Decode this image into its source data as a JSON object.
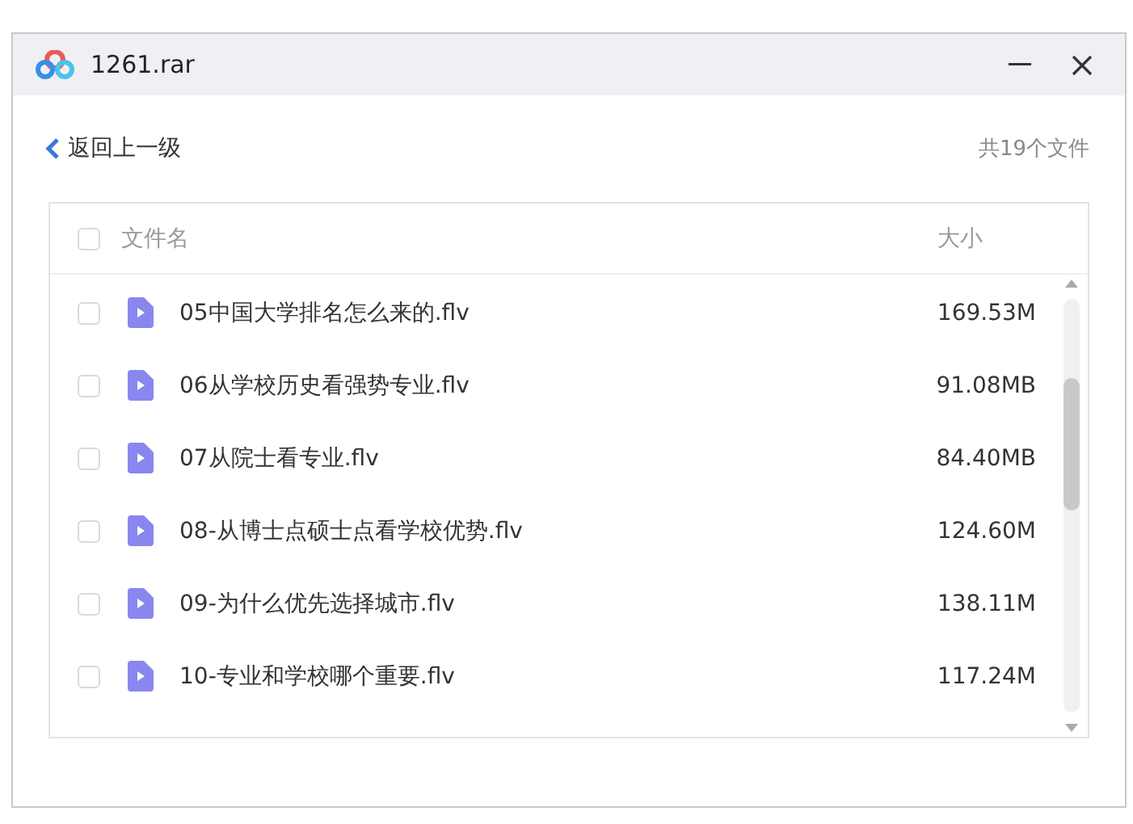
{
  "window": {
    "title": "1261.rar"
  },
  "toolbar": {
    "back": "返回上一级",
    "count": "共19个文件"
  },
  "table": {
    "header": {
      "checked": false,
      "name": "文件名",
      "size": "大小"
    },
    "rows": [
      {
        "checked": false,
        "name": "05中国大学排名怎么来的.flv",
        "size": "169.53M"
      },
      {
        "checked": false,
        "name": "06从学校历史看强势专业.flv",
        "size": "91.08MB"
      },
      {
        "checked": false,
        "name": "07从院士看专业.flv",
        "size": "84.40MB"
      },
      {
        "checked": false,
        "name": "08-从博士点硕士点看学校优势.flv",
        "size": "124.60M"
      },
      {
        "checked": false,
        "name": "09-为什么优先选择城市.flv",
        "size": "138.11M"
      },
      {
        "checked": false,
        "name": "10-专业和学校哪个重要.flv",
        "size": "117.24M"
      }
    ]
  }
}
